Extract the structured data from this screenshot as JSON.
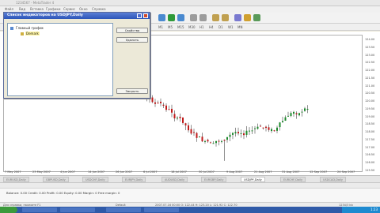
{
  "window": {
    "title": "1234567 - MetaTrader 4"
  },
  "menu": [
    "Файл",
    "Вид",
    "Вставка",
    "Графики",
    "Сервис",
    "Окно",
    "Справка"
  ],
  "timeframes": [
    "M1",
    "M5",
    "M15",
    "M30",
    "H1",
    "H4",
    "D1",
    "W1",
    "MN"
  ],
  "dialog": {
    "title": "Список индикаторов на USDJPY,Daily",
    "tree_root": "Главный график",
    "tree_child": "Demark",
    "buttons": {
      "edit": "Свойства",
      "delete": "Удалить",
      "close": "Закрыть"
    }
  },
  "chart": {
    "symbol_tab": "USDJPY,Daily",
    "y_ticks": [
      "124.00",
      "123.50",
      "123.00",
      "122.50",
      "122.00",
      "121.50",
      "121.00",
      "120.50",
      "120.00",
      "119.50",
      "119.00",
      "118.50",
      "118.00",
      "117.50",
      "117.00",
      "116.50",
      "116.00",
      "115.50"
    ],
    "x_ticks": [
      "7 May 2007",
      "23 May 2007",
      "4 Jun 2007",
      "14 Jun 2007",
      "26 Jun 2007",
      "6 Jul 2007",
      "18 Jul 2007",
      "30 Jul 2007",
      "9 Aug 2007",
      "21 Aug 2007",
      "31 Aug 2007",
      "12 Sep 2007",
      "24 Sep 2007"
    ],
    "colors": {
      "up": "#1a8a2a",
      "down": "#c01818",
      "wick": "#222222"
    }
  },
  "chart_tabs": [
    "EURUSD,Daily",
    "GBPUSD,Daily",
    "USDCHF,Daily",
    "EURJPY,Daily",
    "AUDUSD,Daily",
    "EURGBP,Daily",
    "USDJPY,Daily",
    "EURCHF,Daily",
    "USDCAD,Daily"
  ],
  "terminal": {
    "balance_line": "Balance: 0.00  Credit: 0.00  Profit: 0.00  Equity: 0.00  Margin: 0  Free margin: 0"
  },
  "status": {
    "left": "Для справки, нажмите F1",
    "profile": "Default",
    "ohlc": "2007.07.16 00:00   O: 122.44   H: 123.20   L: 121.92   C: 122.70",
    "conn": "1234/3 kb"
  },
  "clock": "1:23"
}
